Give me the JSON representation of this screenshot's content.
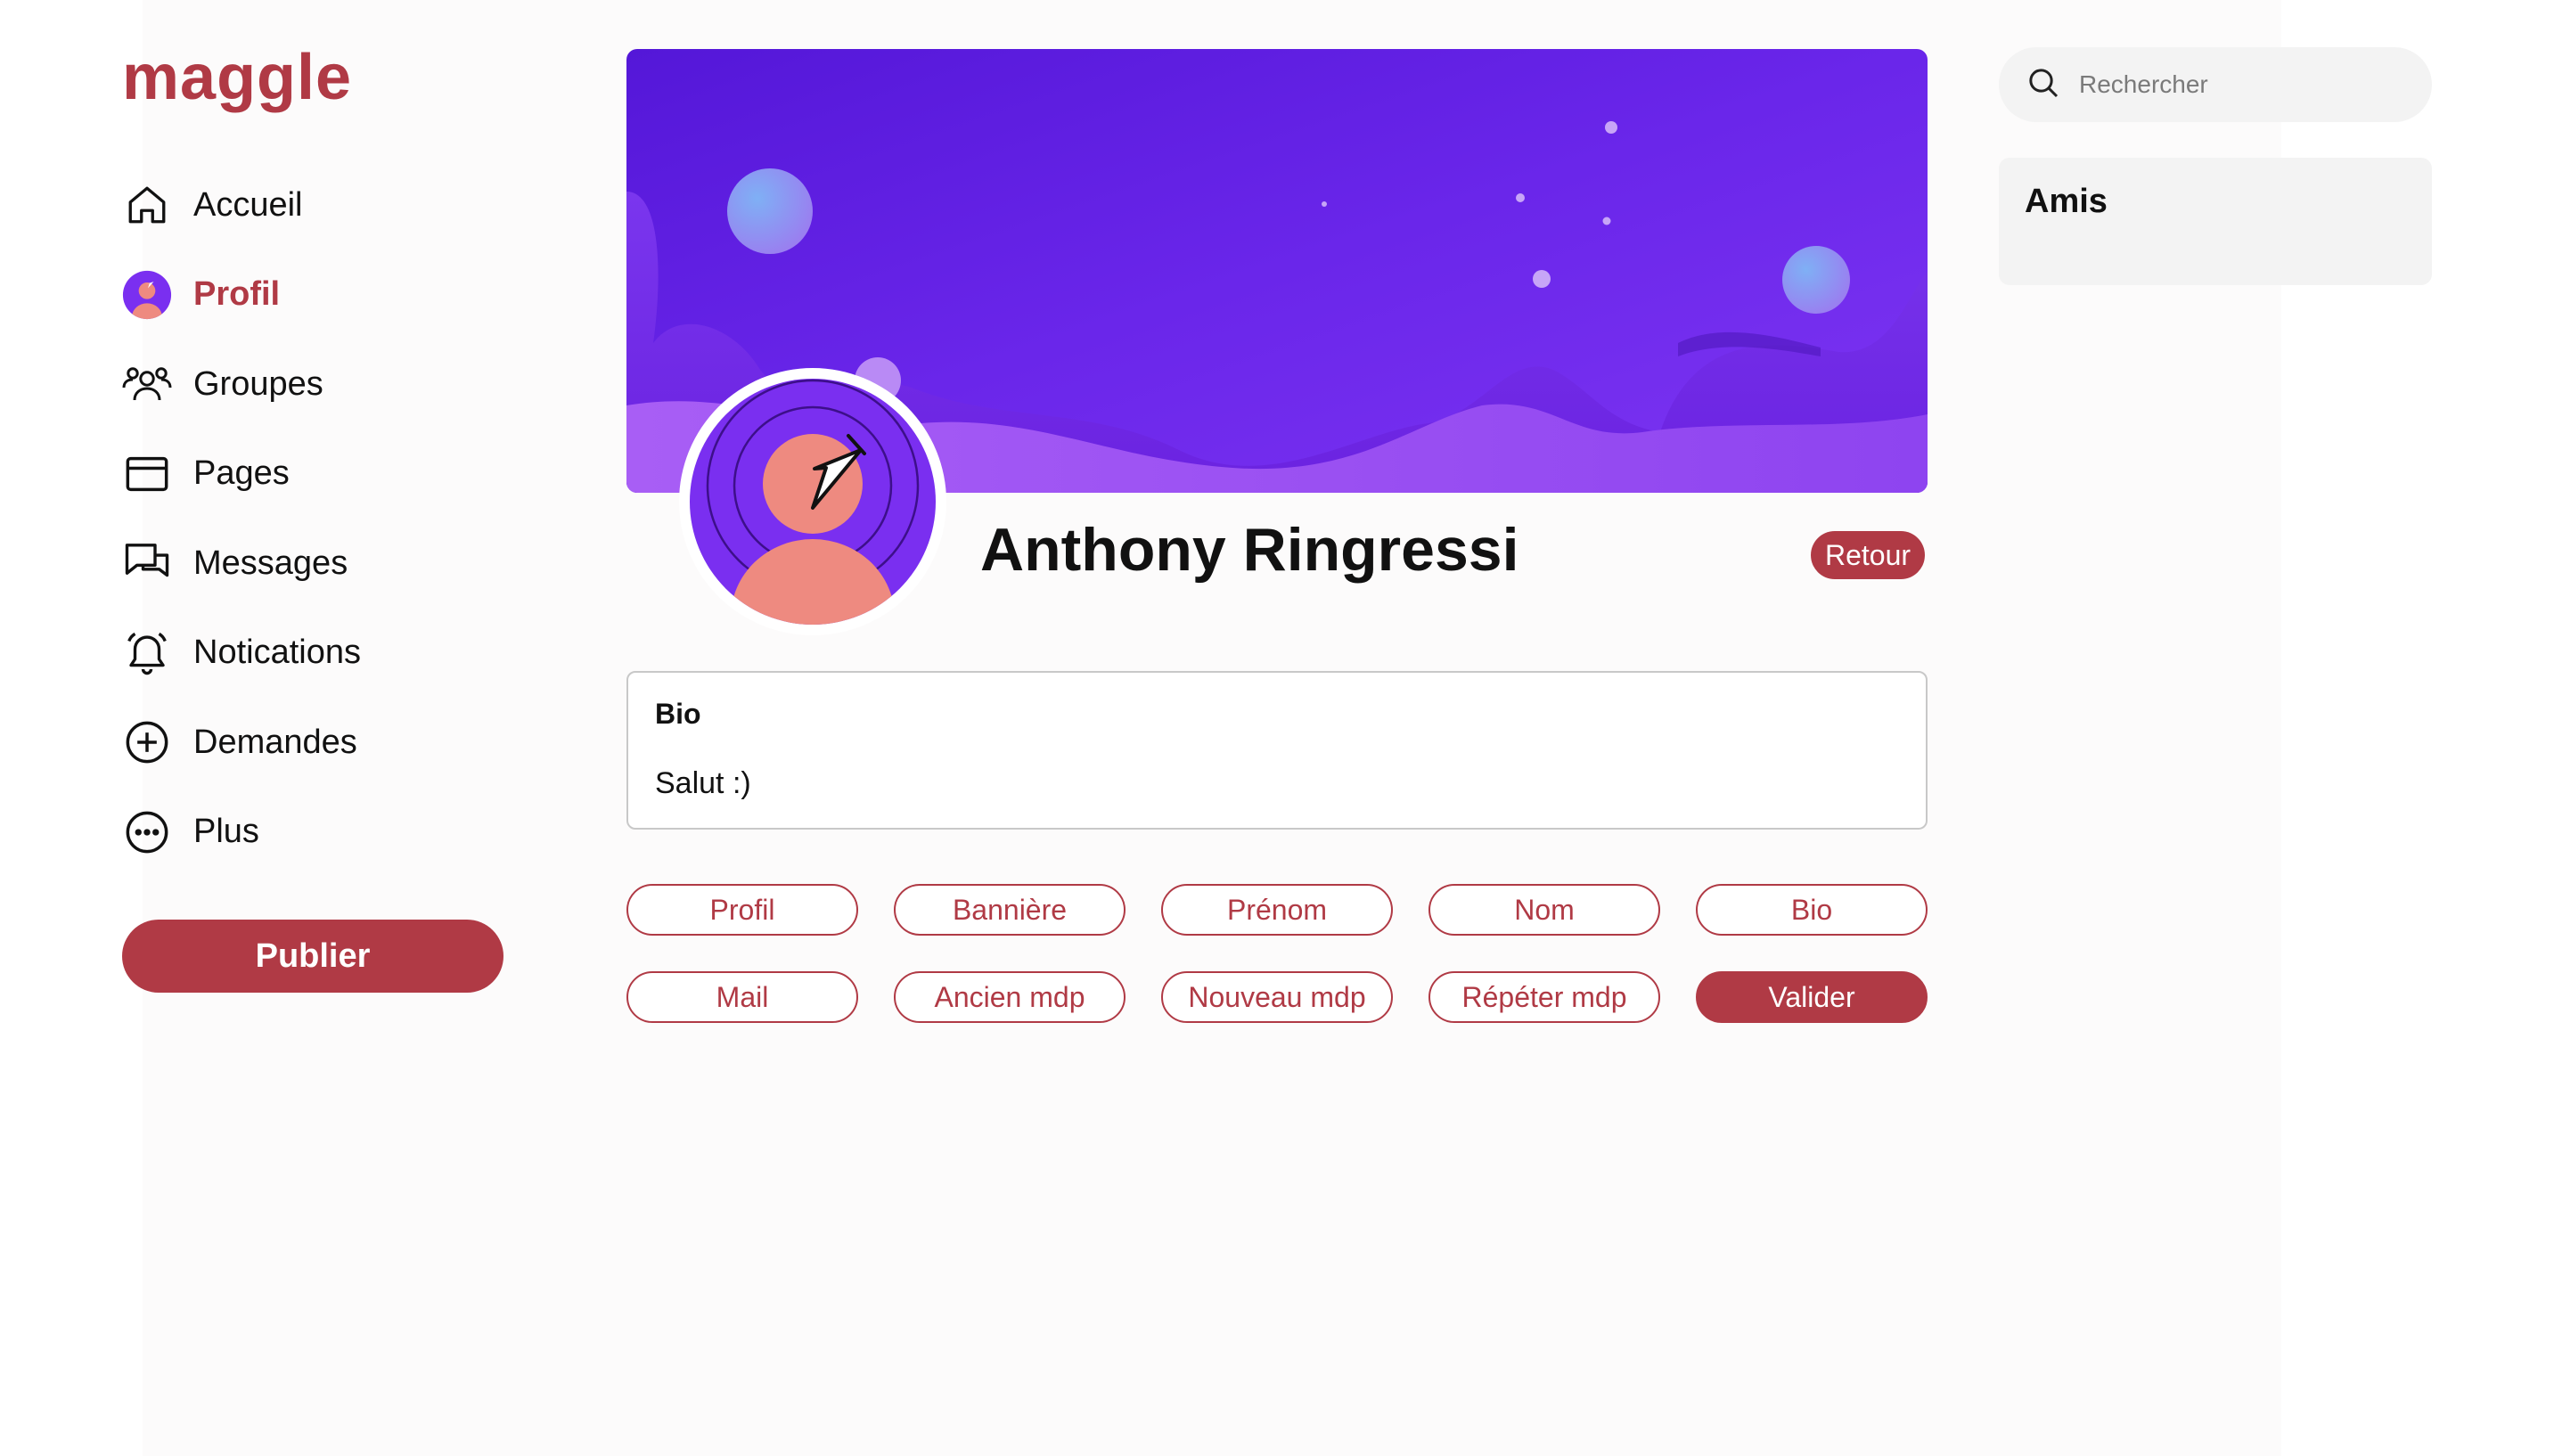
{
  "app": {
    "logo": "maggle"
  },
  "sidebar": {
    "items": [
      {
        "label": "Accueil",
        "icon": "home-icon",
        "active": false
      },
      {
        "label": "Profil",
        "icon": "avatar-icon",
        "active": true
      },
      {
        "label": "Groupes",
        "icon": "groups-icon",
        "active": false
      },
      {
        "label": "Pages",
        "icon": "pages-icon",
        "active": false
      },
      {
        "label": "Messages",
        "icon": "messages-icon",
        "active": false
      },
      {
        "label": "Notications",
        "icon": "bell-icon",
        "active": false
      },
      {
        "label": "Demandes",
        "icon": "plus-circle-icon",
        "active": false
      },
      {
        "label": "Plus",
        "icon": "more-icon",
        "active": false
      }
    ],
    "publish_label": "Publier"
  },
  "profile": {
    "name": "Anthony Ringressi",
    "back_label": "Retour",
    "bio_title": "Bio",
    "bio_text": "Salut :)"
  },
  "edit_buttons": {
    "row1": [
      "Profil",
      "Bannière",
      "Prénom",
      "Nom",
      "Bio"
    ],
    "row2": [
      "Mail",
      "Ancien mdp",
      "Nouveau mdp",
      "Répéter mdp",
      "Valider"
    ]
  },
  "search": {
    "placeholder": "Rechercher"
  },
  "friends": {
    "title": "Amis"
  },
  "colors": {
    "accent": "#b03a45",
    "banner_purple": "#6a24e6",
    "avatar_skin": "#ee8a80"
  }
}
